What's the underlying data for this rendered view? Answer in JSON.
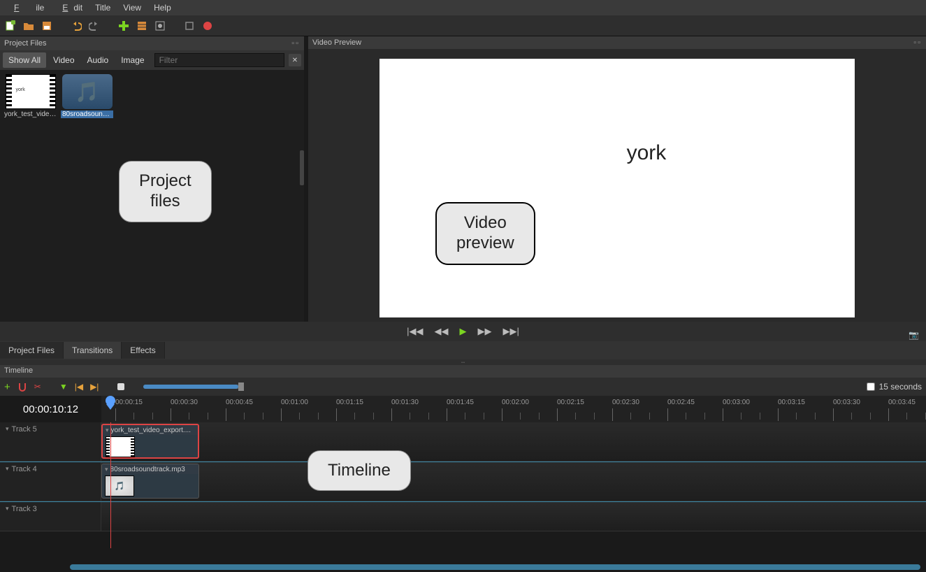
{
  "menu": {
    "file": "File",
    "edit": "Edit",
    "title": "Title",
    "view": "View",
    "help": "Help"
  },
  "panels": {
    "projectFiles": {
      "title": "Project Files"
    },
    "videoPreview": {
      "title": "Video Preview",
      "content_text": "york"
    }
  },
  "pf_toolbar": {
    "showAll": "Show All",
    "video": "Video",
    "audio": "Audio",
    "image": "Image",
    "filter_placeholder": "Filter"
  },
  "pf_items": [
    {
      "label": "york_test_video_...",
      "type": "video"
    },
    {
      "label": "80sroadsoundtr...",
      "type": "audio",
      "selected": true
    }
  ],
  "tabs": {
    "projectFiles": "Project Files",
    "transitions": "Transitions",
    "effects": "Effects"
  },
  "timeline": {
    "title": "Timeline",
    "timecode": "00:00:10:12",
    "snap_label": "15 seconds",
    "ruler": [
      "00:00:15",
      "00:00:30",
      "00:00:45",
      "00:01:00",
      "00:01:15",
      "00:01:30",
      "00:01:45",
      "00:02:00",
      "00:02:15",
      "00:02:30",
      "00:02:45",
      "00:03:00",
      "00:03:15",
      "00:03:30",
      "00:03:45"
    ],
    "tracks": [
      {
        "name": "Track 5",
        "clip": {
          "label": "york_test_video_export....",
          "type": "video",
          "selected": true
        }
      },
      {
        "name": "Track 4",
        "clip": {
          "label": "80sroadsoundtrack.mp3",
          "type": "audio"
        }
      },
      {
        "name": "Track 3"
      }
    ]
  },
  "callouts": {
    "projectFiles": "Project\nfiles",
    "videoPreview": "Video\npreview",
    "timeline": "Timeline"
  }
}
